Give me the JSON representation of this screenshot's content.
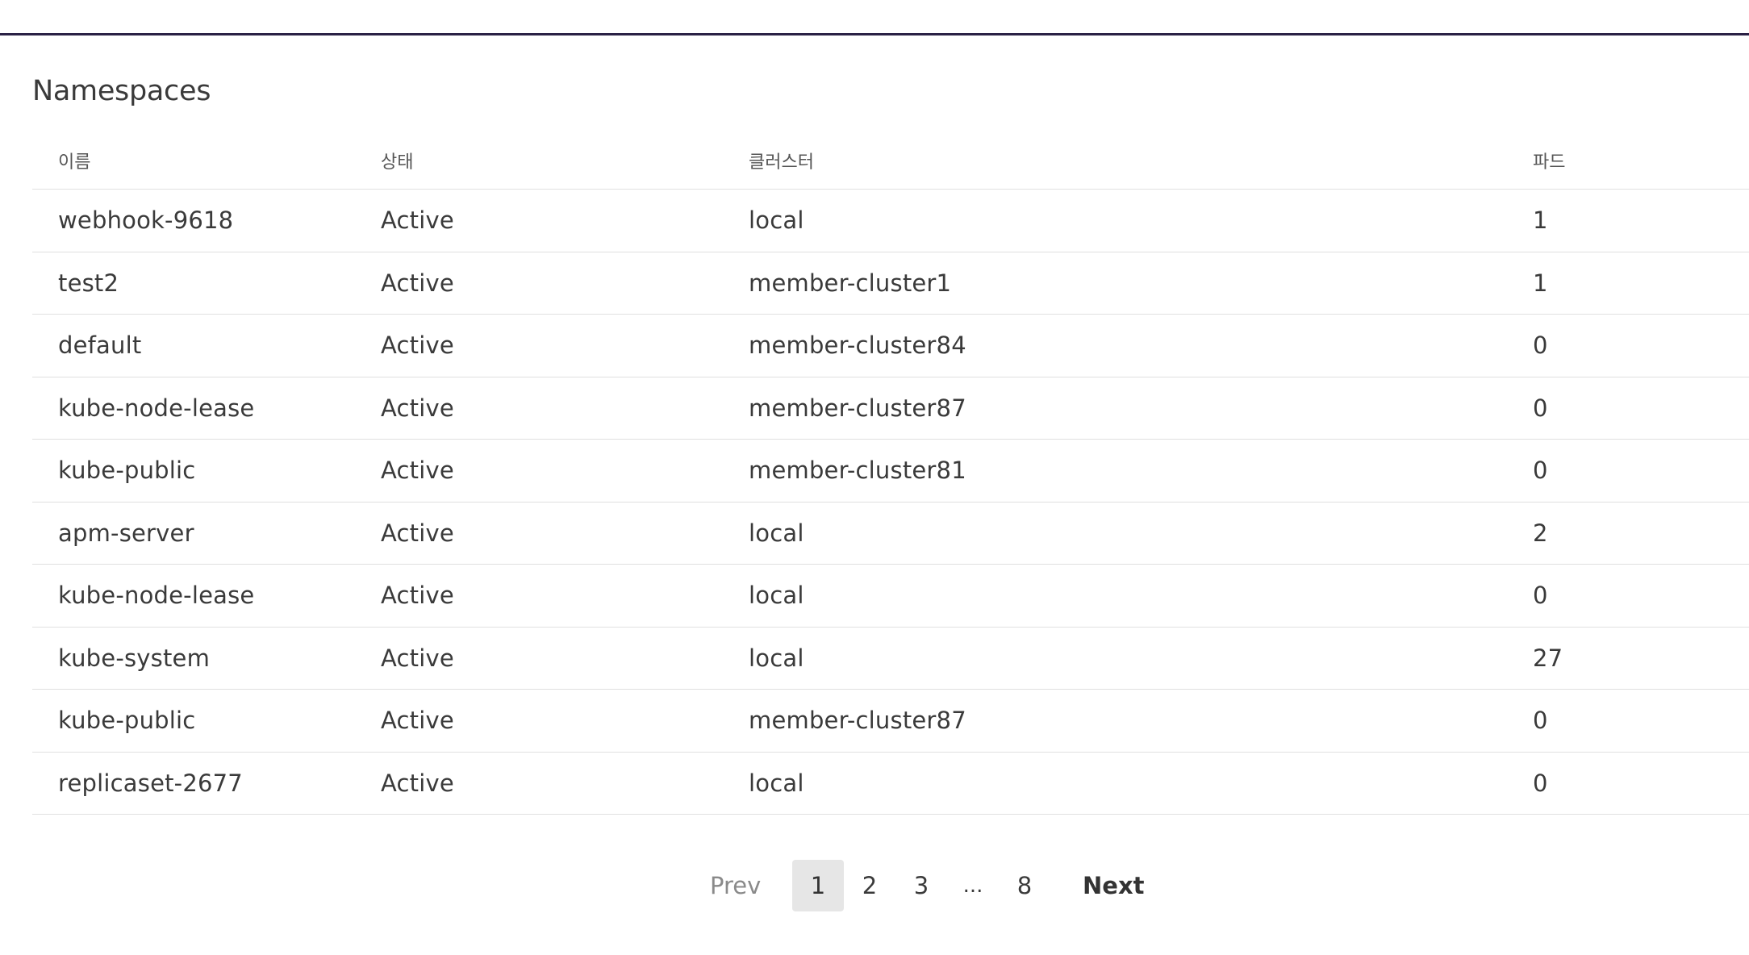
{
  "page": {
    "title": "Namespaces"
  },
  "table": {
    "columns": [
      "이름",
      "상태",
      "클러스터",
      "파드"
    ],
    "rows": [
      {
        "name": "webhook-9618",
        "status": "Active",
        "cluster": "local",
        "pods": "1"
      },
      {
        "name": "test2",
        "status": "Active",
        "cluster": "member-cluster1",
        "pods": "1"
      },
      {
        "name": "default",
        "status": "Active",
        "cluster": "member-cluster84",
        "pods": "0"
      },
      {
        "name": "kube-node-lease",
        "status": "Active",
        "cluster": "member-cluster87",
        "pods": "0"
      },
      {
        "name": "kube-public",
        "status": "Active",
        "cluster": "member-cluster81",
        "pods": "0"
      },
      {
        "name": "apm-server",
        "status": "Active",
        "cluster": "local",
        "pods": "2"
      },
      {
        "name": "kube-node-lease",
        "status": "Active",
        "cluster": "local",
        "pods": "0"
      },
      {
        "name": "kube-system",
        "status": "Active",
        "cluster": "local",
        "pods": "27"
      },
      {
        "name": "kube-public",
        "status": "Active",
        "cluster": "member-cluster87",
        "pods": "0"
      },
      {
        "name": "replicaset-2677",
        "status": "Active",
        "cluster": "local",
        "pods": "0"
      }
    ]
  },
  "pagination": {
    "prev_label": "Prev",
    "next_label": "Next",
    "pages": [
      "1",
      "2",
      "3",
      "...",
      "8"
    ],
    "current_page": "1"
  },
  "colors": {
    "top_rule": "#2a2145",
    "active_page_bg": "#e6e6e6",
    "row_divider": "#e0e0e0"
  }
}
